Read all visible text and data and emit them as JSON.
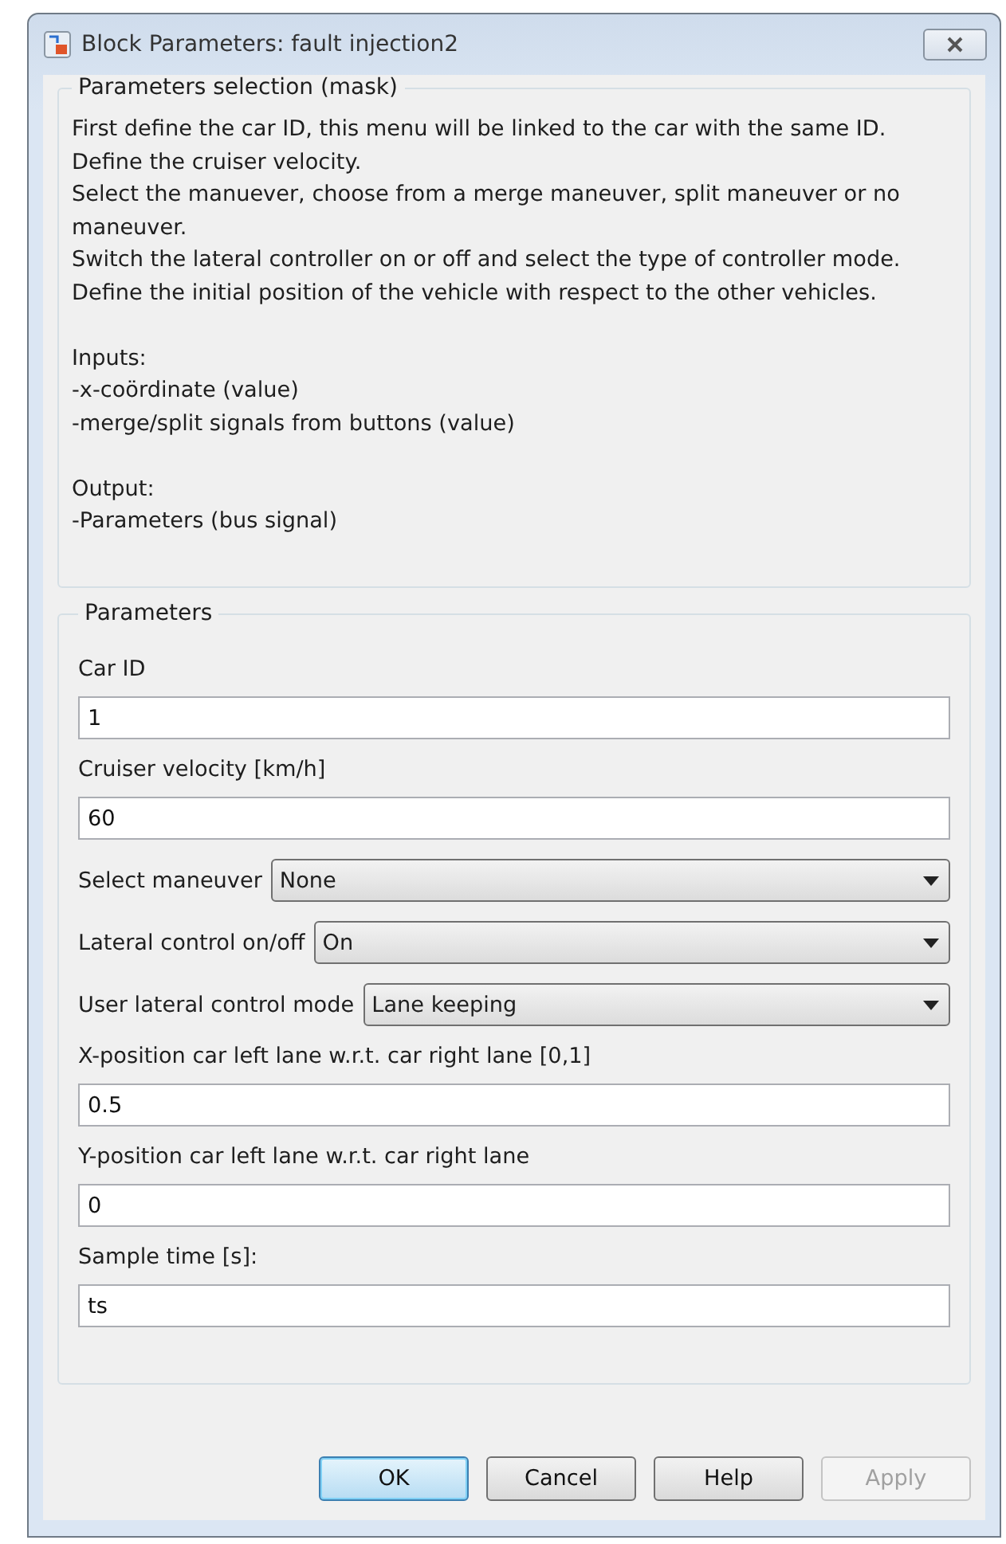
{
  "window": {
    "title": "Block Parameters: fault injection2"
  },
  "description": {
    "title": "Parameters selection (mask)",
    "paragraphs": [
      [
        "First define the car ID, this menu will be linked to the car with the same ID.",
        "Define the cruiser velocity.",
        "Select the manuever, choose from a merge maneuver, split maneuver or no",
        "maneuver.",
        "Switch the lateral controller on or off and select the type of controller mode.",
        "Define the initial position of the vehicle with respect to the other vehicles."
      ],
      [
        "Inputs:",
        "-x-coördinate (value)",
        "-merge/split signals from buttons (value)"
      ],
      [
        "Output:",
        "-Parameters (bus signal)"
      ]
    ]
  },
  "parameters": {
    "title": "Parameters",
    "items": [
      {
        "kind": "edit",
        "label": "Car ID",
        "value": "1"
      },
      {
        "kind": "edit",
        "label": "Cruiser velocity [km/h]",
        "value": "60"
      },
      {
        "kind": "popup",
        "label": "Select maneuver",
        "value": "None"
      },
      {
        "kind": "popup",
        "label": "Lateral control on/off",
        "value": "On"
      },
      {
        "kind": "popup",
        "label": "User lateral control mode",
        "value": "Lane keeping"
      },
      {
        "kind": "edit",
        "label": "X-position car left lane w.r.t. car right lane [0,1]",
        "value": "0.5"
      },
      {
        "kind": "edit",
        "label": "Y-position car left lane w.r.t. car right lane",
        "value": "0"
      },
      {
        "kind": "edit",
        "label": "Sample time [s]:",
        "value": "ts"
      }
    ]
  },
  "buttons": [
    {
      "label": "OK",
      "default": true,
      "disabled": false
    },
    {
      "label": "Cancel",
      "default": false,
      "disabled": false
    },
    {
      "label": "Help",
      "default": false,
      "disabled": false
    },
    {
      "label": "Apply",
      "default": false,
      "disabled": true
    }
  ]
}
